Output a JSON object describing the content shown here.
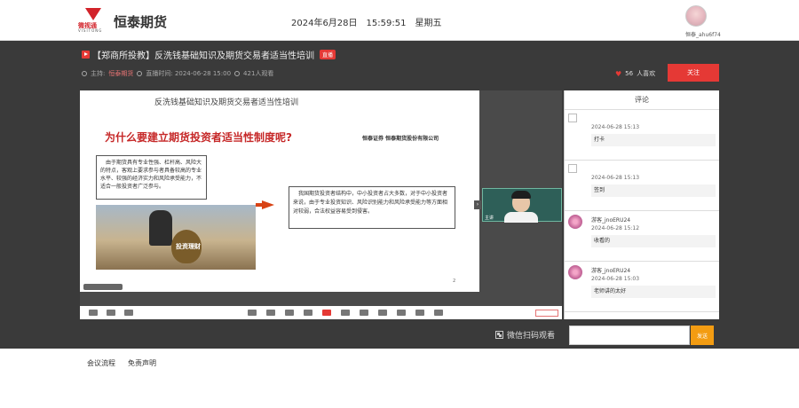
{
  "header": {
    "logo_text": "微视通",
    "logo_sub": "VISITONG",
    "brand": "恒泰期货",
    "date": "2024年6月28日",
    "time": "15:59:51",
    "weekday": "星期五",
    "username": "恒泰_ahu6f74"
  },
  "stream": {
    "title": "【郑商所投教】反洗钱基础知识及期货交易者适当性培训",
    "live_badge": "直播",
    "host_label": "主持:",
    "host_name": "恒泰期货",
    "start_label": "直播时间: 2024-06-28 15:00",
    "viewers": "421人观看",
    "likes_count": "56",
    "likes_label": "人喜欢",
    "follow_label": "关注"
  },
  "slide": {
    "header_title": "反洗钱基础知识及期货交易者适当性培训",
    "title": "为什么要建立期货投资者适当性制度呢?",
    "company": "恒泰证券 恒泰期货股份有限公司",
    "left_text": "由于期货具有专业性强、杠杆高、风险大的特点，客观上要求参与者具备较高的专业水平、较强的经济实力和风险承受能力，不适合一般投资者广泛参与。",
    "right_text": "我国期货投资者结构中，中小投资者占大多数，对于中小投资者来说，由于专业投资知识、风险识别能力和风险承受能力等方面相对较弱，合法权益容易受到侵害。",
    "bag_label": "投资理财",
    "page_num": "2",
    "webcam_tag": "主讲"
  },
  "scan_label": "微信扫码观看",
  "comments": {
    "header": "评论",
    "items": [
      {
        "name": "",
        "time": "2024-06-28 15:13",
        "text": "打卡",
        "avatar": "broken"
      },
      {
        "name": "",
        "time": "2024-06-28 15:13",
        "text": "签到",
        "avatar": "broken"
      },
      {
        "name": "游客_jnoERU24",
        "time": "2024-06-28 15:12",
        "text": "收看的",
        "avatar": "pink"
      },
      {
        "name": "游客_jnoERU24",
        "time": "2024-06-28 15:03",
        "text": "老师讲的太好",
        "avatar": "pink"
      }
    ],
    "send_label": "发送"
  },
  "tabs": [
    "会议流程",
    "免责声明"
  ],
  "colors": {
    "accent": "#e53935",
    "send": "#f39c12",
    "band": "#3a3a3a"
  }
}
